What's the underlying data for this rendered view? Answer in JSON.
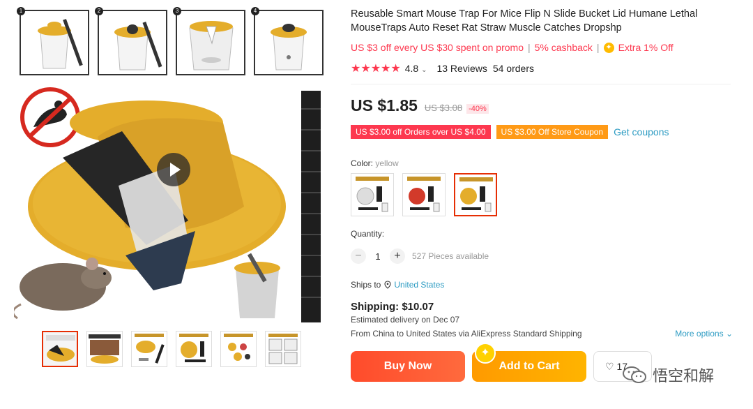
{
  "gallery": {
    "steps": [
      {
        "num": "1",
        "icon": "bucket-step-icon"
      },
      {
        "num": "2",
        "icon": "bucket-step-icon"
      },
      {
        "num": "3",
        "icon": "bucket-step-icon"
      },
      {
        "num": "4",
        "icon": "bucket-step-icon"
      }
    ],
    "play_icon": "play-icon",
    "thumbnail_count": 6,
    "active_thumbnail": 1
  },
  "product": {
    "title": "Reusable Smart Mouse Trap For Mice Flip N Slide Bucket Lid Humane Lethal MouseTraps Auto Reset Rat Straw Muscle Catches Dropshp",
    "promo_text": "US $3 off every US $30 spent on promo",
    "cashback_text": "5% cashback",
    "extra_text": "Extra 1% Off",
    "separator": "|",
    "rating": "4.8",
    "stars": 5,
    "reviews": "13 Reviews",
    "orders": "54 orders",
    "price": "US $1.85",
    "old_price": "US $3.08",
    "discount": "-40%",
    "coupon_1": "US $3.00 off Orders over US $4.00",
    "coupon_2": "US $3.00 Off Store Coupon",
    "get_coupons": "Get coupons",
    "color_label": "Color:",
    "color_value": "yellow",
    "colors": [
      "white",
      "red",
      "yellow"
    ],
    "selected_color": "yellow",
    "quantity_label": "Quantity:",
    "quantity": "1",
    "minus": "−",
    "plus": "+",
    "available": "527 Pieces available",
    "ships_to_label": "Ships to",
    "ships_to": "United States",
    "shipping": "Shipping: $10.07",
    "delivery": "Estimated delivery on Dec 07",
    "route": "From China to United States via AliExpress Standard Shipping",
    "more_options": "More options",
    "buy_now": "Buy Now",
    "add_to_cart": "Add to Cart",
    "wishlist_count": "17"
  },
  "watermark": {
    "text": "悟空和解"
  },
  "colors": {
    "accent_red": "#fd384f",
    "link_blue": "#2e9cc3",
    "buy_orange": "#ff4b2b",
    "cart_yellow": "#ffa800",
    "trap_yellow": "#e4ad2b"
  }
}
